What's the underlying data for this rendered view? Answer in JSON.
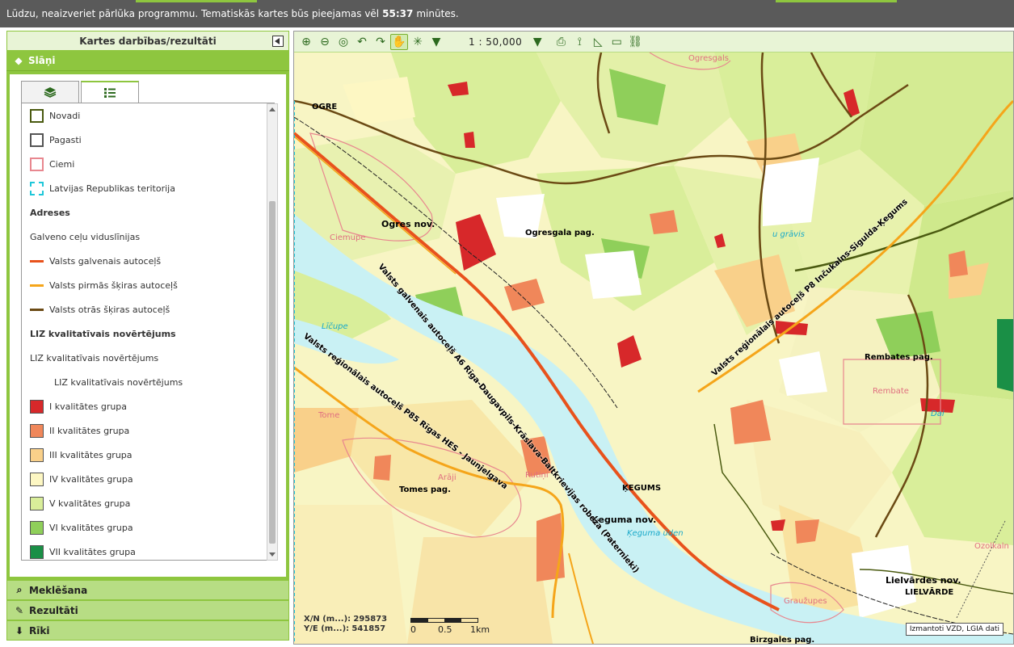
{
  "banner": {
    "text_before": "Lūdzu, neaizveriet pārlūka programmu. Tematiskās kartes būs pieejamas vēl",
    "time": "55:37",
    "text_after": "minūtes."
  },
  "panel": {
    "title": "Kartes darbības/rezultāti",
    "layers_section": "Slāņi",
    "search_section": "Meklēšana",
    "results_section": "Rezultāti",
    "tools_section": "Rīki"
  },
  "legend": {
    "items": [
      {
        "label": "Novadi",
        "kind": "box",
        "color": "#4a5a10"
      },
      {
        "label": "Pagasti",
        "kind": "box",
        "color": "#555555"
      },
      {
        "label": "Ciemi",
        "kind": "box",
        "color": "#e8878f"
      },
      {
        "label": "Latvijas Republikas teritorija",
        "kind": "dash",
        "color": "#1fc7d9"
      },
      {
        "label": "Adreses",
        "kind": "head"
      },
      {
        "label": "Galveno ceļu viduslīnijas",
        "kind": "text"
      },
      {
        "label": "Valsts galvenais autoceļš",
        "kind": "line",
        "color": "#e8521c"
      },
      {
        "label": "Valsts pirmās šķiras autoceļš",
        "kind": "line",
        "color": "#f5a51a"
      },
      {
        "label": "Valsts otrās šķiras autoceļš",
        "kind": "line",
        "color": "#6b4a14"
      },
      {
        "label": "LIZ kvalitatīvais novērtējums",
        "kind": "head"
      },
      {
        "label": "LIZ kvalitatīvais novērtējums",
        "kind": "text"
      },
      {
        "label": "LIZ kvalitatīvais novērtējums",
        "kind": "subtext"
      },
      {
        "label": "I kvalitātes grupa",
        "kind": "fill",
        "color": "#d7282a"
      },
      {
        "label": "II kvalitātes grupa",
        "kind": "fill",
        "color": "#f0875a"
      },
      {
        "label": "III kvalitātes grupa",
        "kind": "fill",
        "color": "#f9d08a"
      },
      {
        "label": "IV kvalitātes grupa",
        "kind": "fill",
        "color": "#fdf7c3"
      },
      {
        "label": "V kvalitātes grupa",
        "kind": "fill",
        "color": "#d9ee9a"
      },
      {
        "label": "VI kvalitātes grupa",
        "kind": "fill",
        "color": "#8fcf5a"
      },
      {
        "label": "VII kvalitātes grupa",
        "kind": "fill",
        "color": "#1a8f46"
      }
    ]
  },
  "toolbar": {
    "scale": "1 : 50,000",
    "icons": [
      "zoom-in-icon",
      "zoom-out-icon",
      "full-extent-icon",
      "back-icon",
      "forward-icon",
      "pan-icon",
      "select-icon",
      "dropdown-icon"
    ],
    "right_icons": [
      "print-icon",
      "measure-icon",
      "area-icon",
      "comment-icon",
      "link-icon"
    ]
  },
  "map": {
    "labels": {
      "ogre": "OGRE",
      "ogresgals": "Ogresgals",
      "ogres_nov": "Ogres nov.",
      "ogresgala_pag": "Ogresgala pag.",
      "ciemupe": "Ciemupe",
      "licupe": "Līčupe",
      "tome": "Tome",
      "araji": "Arāji",
      "tomes_pag": "Tomes pag.",
      "rutini": "Rutiņi",
      "kegums": "ĶEGUMS",
      "keguma_nov": "Ķeguma nov.",
      "keguma_udens": "Ķeguma ūden",
      "rembates_pag": "Rembates pag.",
      "rembate": "Rembate",
      "lielvardes_nov": "Lielvārdes nov.",
      "lielvarde": "LIELVĀRDE",
      "grauzupes": "Graužupes",
      "birzgales_pag": "Birzgales pag.",
      "ozolkaln": "Ozolkaln",
      "dai": "Dai",
      "gravis": "u grāvis",
      "road_a6": "Valsts galvenais autoceļš A6 Rīga-Daugavpils-Krāslava-Baltkrievijas robeža (Paternieki)",
      "road_p8": "Valsts reģionālais autoceļš P8 Inčukalns-Sigulda-Ķegums",
      "road_p85": "Valsts reģionālais autoceļš P85 Rīgas HES - Jaunjelgava"
    },
    "coords": {
      "x_label": "X/N (m...):",
      "x_value": "295873",
      "y_label": "Y/E (m...):",
      "y_value": "541857"
    },
    "scalebar": {
      "l0": "0",
      "l1": "0.5",
      "l2": "1km"
    },
    "attribution": "Izmantoti VZD, LGIA dati"
  }
}
